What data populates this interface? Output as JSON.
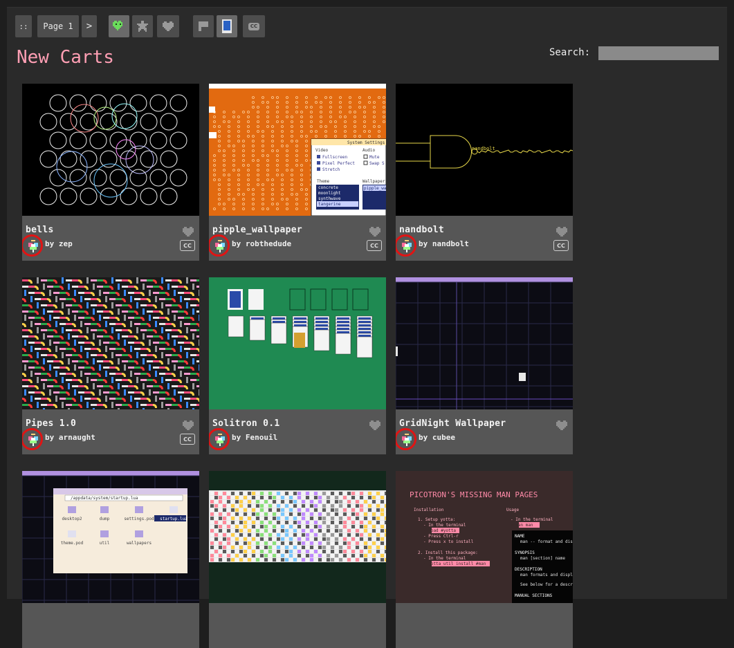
{
  "toolbar": {
    "grip_label": "::",
    "page_label": "Page 1",
    "next_label": ">",
    "filters": [
      "heart-green-icon",
      "star-icon",
      "heart-icon"
    ],
    "views": [
      "flag-icon",
      "cart-icon",
      "cc-icon"
    ]
  },
  "header": {
    "title": "New Carts",
    "search_label": "Search:",
    "search_value": ""
  },
  "colors": {
    "accent_title": "#ff9fb4",
    "card_bg": "#565656",
    "annotation_red": "#e01414"
  },
  "carts": [
    {
      "title": "bells",
      "author": "by zep",
      "cc": "CC"
    },
    {
      "title": "pipple_wallpaper",
      "author": "by robthedude",
      "cc": "CC"
    },
    {
      "title": "nandbolt",
      "author": "by nandbolt",
      "cc": "CC"
    },
    {
      "title": "Pipes 1.0",
      "author": "by arnaught",
      "cc": "CC"
    },
    {
      "title": "Solitron 0.1",
      "author": "by Fenouil",
      "cc": ""
    },
    {
      "title": "GridNight Wallpaper",
      "author": "by cubee",
      "cc": ""
    },
    {
      "title": "",
      "author": "",
      "cc": ""
    },
    {
      "title": "",
      "author": "",
      "cc": ""
    },
    {
      "title": "",
      "author": "",
      "cc": ""
    }
  ],
  "thumbs": {
    "wallpaper": {
      "window_title": "System Settings",
      "video": "Video",
      "audio": "Audio",
      "opt_fullscreen": "Fullscreen",
      "opt_pixel": "Pixel Perfect",
      "opt_stretch": "Stretch",
      "opt_mute": "Mute",
      "opt_swap": "Swap S",
      "theme_label": "Theme",
      "wallpaper_label": "Wallpaper",
      "themes": [
        "concrete",
        "moonlight",
        "synthwave",
        "tangerine"
      ],
      "wallpaper_value": "pipple_wa"
    },
    "nandbolt_label": "nandbolt",
    "desktop": {
      "path": "/appdata/system/startup.lua",
      "files": [
        "desktop2",
        "dump",
        "settings.pod",
        "startup.lua",
        "theme.pod",
        "util",
        "wallpapers"
      ]
    },
    "manpages": {
      "heading": "PICOTRON'S MISSING MAN PAGES",
      "installation": "Installation",
      "usage": "Usage",
      "step1": "1. Setup yotta:",
      "step1a": "- In the terminal",
      "step1b": "> load #yotta",
      "step1c": "- Press Ctrl-r",
      "step1d": "- Press x to install",
      "step2": "2. Install this package:",
      "step2a": "- In the terminal",
      "step2b": "> yotta util install #man",
      "usage1": "- In the terminal",
      "usage2": "> man man",
      "name_h": "NAME",
      "name_t": "man -- format and dis",
      "syn_h": "SYNOPSIS",
      "syn_t": "man [section] name",
      "desc_h": "DESCRIPTION",
      "desc_t": "man formats and displ",
      "desc_t2": "See below for a descr",
      "manual_h": "MANUAL SECTIONS"
    }
  }
}
